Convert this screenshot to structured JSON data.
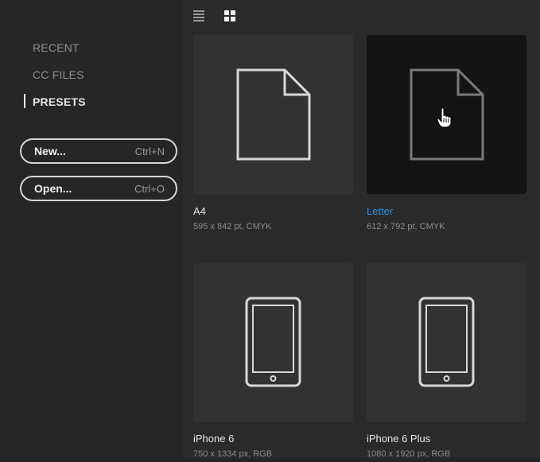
{
  "sidebar": {
    "items": [
      {
        "label": "RECENT"
      },
      {
        "label": "CC FILES"
      },
      {
        "label": "PRESETS"
      }
    ],
    "new_button": {
      "label": "New...",
      "shortcut": "Ctrl+N"
    },
    "open_button": {
      "label": "Open...",
      "shortcut": "Ctrl+O"
    }
  },
  "toolbar": {
    "list_view_icon": "list-view-icon",
    "grid_view_icon": "grid-view-icon"
  },
  "presets": [
    {
      "name": "A4",
      "details": "595 x 842 pt, CMYK",
      "icon": "document-icon"
    },
    {
      "name": "Letter",
      "details": "612 x 792 pt, CMYK",
      "icon": "document-icon",
      "selected": true
    },
    {
      "name": "iPhone 6",
      "details": "750 x 1334 px, RGB",
      "icon": "phone-icon"
    },
    {
      "name": "iPhone 6 Plus",
      "details": "1080 x 1920 px, RGB",
      "icon": "phone-icon"
    }
  ],
  "colors": {
    "accent": "#2b8fe0",
    "background": "#262626",
    "card": "#323232",
    "card_selected": "#141414"
  }
}
